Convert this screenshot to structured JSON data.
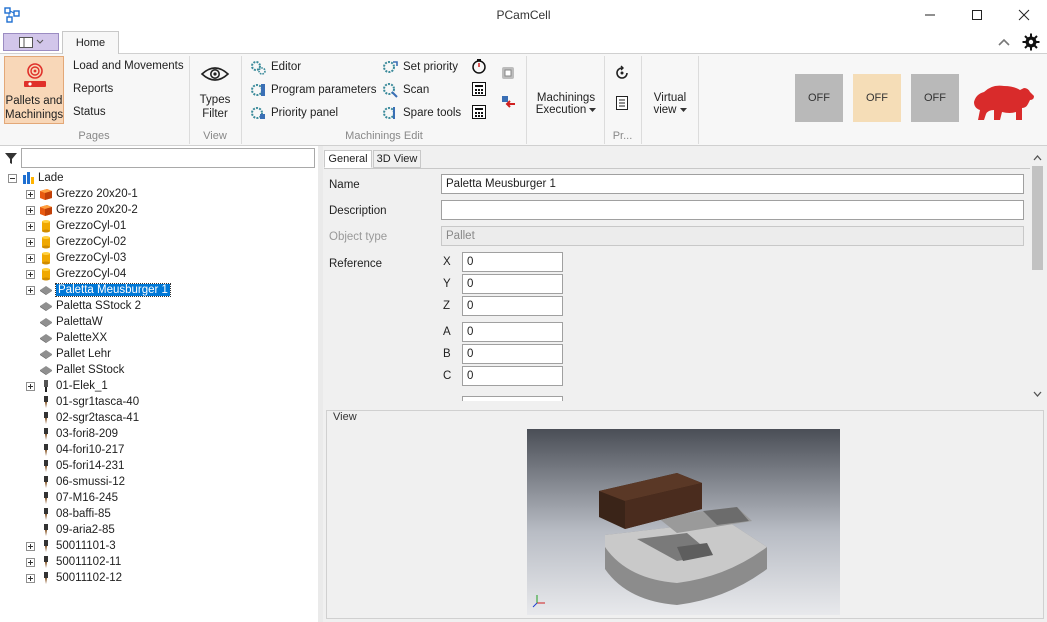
{
  "window": {
    "title": "PCamCell",
    "controls": [
      "minimize",
      "maximize",
      "close"
    ]
  },
  "ribbon": {
    "tabs": [
      "Home"
    ],
    "groups": {
      "pages": {
        "label": "Pages",
        "pallets_label_1": "Pallets and",
        "pallets_label_2": "Machinings",
        "items": [
          "Load and Movements",
          "Reports",
          "Status"
        ]
      },
      "view": {
        "label": "View",
        "types_filter_1": "Types",
        "types_filter_2": "Filter"
      },
      "machinings_edit": {
        "label": "Machinings Edit",
        "col1": [
          "Editor",
          "Program parameters",
          "Priority panel"
        ],
        "col2": [
          "Set priority",
          "Scan",
          "Spare tools"
        ]
      },
      "execution": {
        "label_1": "Machinings",
        "label_2": "Execution"
      },
      "pr": {
        "label": "Pr..."
      },
      "virtual": {
        "label_1": "Virtual",
        "label_2": "view"
      }
    },
    "status_buttons": [
      {
        "label": "OFF",
        "color": "#b9b9b9"
      },
      {
        "label": "OFF",
        "color": "#f5ddb7"
      },
      {
        "label": "OFF",
        "color": "#b9b9b9"
      }
    ],
    "brand_color": "#d92b2b"
  },
  "tree": {
    "filter_value": "",
    "root": "Lade",
    "items": [
      {
        "label": "Grezzo 20x20-1",
        "icon": "box-icon",
        "expand": "plus"
      },
      {
        "label": "Grezzo 20x20-2",
        "icon": "box-icon",
        "expand": "plus"
      },
      {
        "label": "GrezzoCyl-01",
        "icon": "cylinder-icon",
        "expand": "plus"
      },
      {
        "label": "GrezzoCyl-02",
        "icon": "cylinder-icon",
        "expand": "plus"
      },
      {
        "label": "GrezzoCyl-03",
        "icon": "cylinder-icon",
        "expand": "plus"
      },
      {
        "label": "GrezzoCyl-04",
        "icon": "cylinder-icon",
        "expand": "plus"
      },
      {
        "label": "Paletta Meusburger 1",
        "icon": "pallet-icon",
        "expand": "plus",
        "selected": true
      },
      {
        "label": "Paletta SStock 2",
        "icon": "pallet-icon",
        "expand": "none"
      },
      {
        "label": "PalettaW",
        "icon": "pallet-icon",
        "expand": "none"
      },
      {
        "label": "PaletteXX",
        "icon": "pallet-icon",
        "expand": "none"
      },
      {
        "label": "Pallet Lehr",
        "icon": "pallet-icon",
        "expand": "none"
      },
      {
        "label": "Pallet SStock",
        "icon": "pallet-icon",
        "expand": "none"
      },
      {
        "label": "01-Elek_1",
        "icon": "electrode-icon",
        "expand": "plus"
      },
      {
        "label": "01-sgr1tasca-40",
        "icon": "tool-icon",
        "expand": "none"
      },
      {
        "label": "02-sgr2tasca-41",
        "icon": "tool-icon",
        "expand": "none"
      },
      {
        "label": "03-fori8-209",
        "icon": "tool-icon",
        "expand": "none"
      },
      {
        "label": "04-fori10-217",
        "icon": "tool-icon",
        "expand": "none"
      },
      {
        "label": "05-fori14-231",
        "icon": "tool-icon",
        "expand": "none"
      },
      {
        "label": "06-smussi-12",
        "icon": "tool-icon",
        "expand": "none"
      },
      {
        "label": "07-M16-245",
        "icon": "tool-icon",
        "expand": "none"
      },
      {
        "label": "08-baffi-85",
        "icon": "tool-icon",
        "expand": "none"
      },
      {
        "label": "09-aria2-85",
        "icon": "tool-icon",
        "expand": "none"
      },
      {
        "label": "50011101-3",
        "icon": "tool-icon",
        "expand": "plus"
      },
      {
        "label": "50011102-11",
        "icon": "tool-icon",
        "expand": "plus"
      },
      {
        "label": "50011102-12",
        "icon": "tool-icon",
        "expand": "plus"
      }
    ]
  },
  "detail": {
    "tabs": [
      "General",
      "3D View"
    ],
    "name_label": "Name",
    "name_value": "Paletta Meusburger 1",
    "description_label": "Description",
    "description_value": "",
    "object_type_label": "Object type",
    "object_type_value": "Pallet",
    "reference_label": "Reference",
    "coords": [
      {
        "axis": "X",
        "value": "0"
      },
      {
        "axis": "Y",
        "value": "0"
      },
      {
        "axis": "Z",
        "value": "0"
      },
      {
        "axis": "A",
        "value": "0"
      },
      {
        "axis": "B",
        "value": "0"
      },
      {
        "axis": "C",
        "value": "0"
      }
    ],
    "view_label": "View"
  }
}
